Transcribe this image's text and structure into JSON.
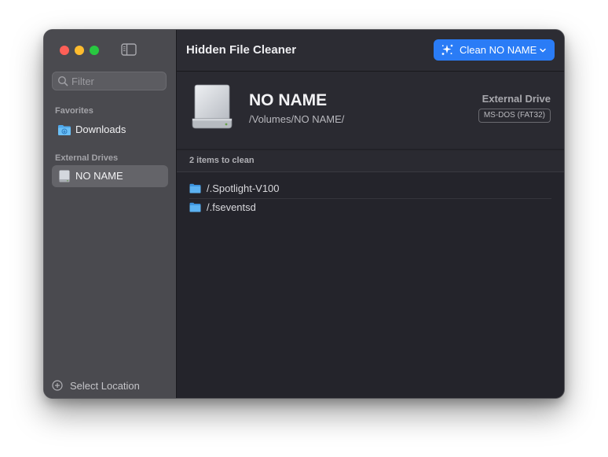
{
  "window": {
    "app_title": "Hidden File Cleaner"
  },
  "sidebar": {
    "toggle_icon": "sidebar-toggle-icon",
    "filter_placeholder": "Filter",
    "sections": {
      "favorites": {
        "header": "Favorites",
        "items": [
          {
            "label": "Downloads",
            "icon": "downloads-folder-icon"
          }
        ]
      },
      "external": {
        "header": "External Drives",
        "items": [
          {
            "label": "NO NAME",
            "icon": "external-drive-icon",
            "selected": true
          }
        ]
      }
    },
    "select_location_label": "Select Location"
  },
  "toolbar": {
    "clean_button_label": "Clean NO NAME",
    "clean_button_icon": "sparkle-icon"
  },
  "drive": {
    "name": "NO NAME",
    "path": "/Volumes/NO NAME/",
    "kind": "External Drive",
    "filesystem": "MS-DOS (FAT32)"
  },
  "items": {
    "count_label": "2 items to clean",
    "files": [
      {
        "name": "/.Spotlight-V100",
        "icon": "folder-icon"
      },
      {
        "name": "/.fseventsd",
        "icon": "folder-icon"
      }
    ]
  },
  "colors": {
    "accent": "#2a7cf6",
    "sidebar_bg": "#4a4a4f",
    "main_bg": "#24242b",
    "close": "#fe5f57",
    "minimize": "#febc2e",
    "maximize": "#28c840",
    "folder": "#58b4f0"
  }
}
